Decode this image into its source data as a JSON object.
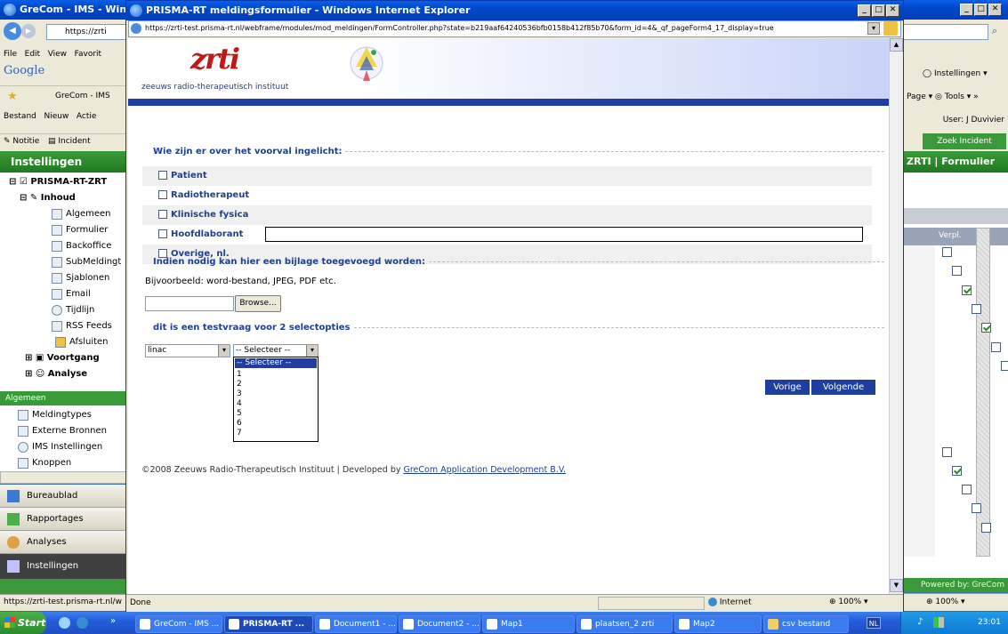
{
  "bg_window": {
    "title": "GreCom - IMS - Windo",
    "url": "https://zrti",
    "menu": [
      "File",
      "Edit",
      "View",
      "Favorit"
    ],
    "tab": "GreCom - IMS",
    "app_menu": [
      "Bestand",
      "Nieuw",
      "Actie"
    ],
    "toolbar": [
      "Notitie",
      "Incident"
    ],
    "sidebar_header": "Instellingen",
    "tree_root": "PRISMA-RT-ZRT",
    "tree_inhoud": "Inhoud",
    "tree_items": [
      "Algemeen",
      "Formulier",
      "Backoffice",
      "SubMeldingt",
      "Sjablonen",
      "Email",
      "Tijdlijn",
      "RSS Feeds",
      "Afsluiten"
    ],
    "tree_voortgang": "Voortgang",
    "tree_analyse": "Analyse",
    "algemeen_header": "Algemeen",
    "algemeen_items": [
      "Meldingtypes",
      "Externe Bronnen",
      "IMS Instellingen",
      "Knoppen"
    ],
    "nav_buttons": [
      "Bureaublad",
      "Rapportages",
      "Analyses",
      "Instellingen"
    ],
    "status_url": "https://zrti-test.prisma-rt.nl/w"
  },
  "right_window": {
    "instellingen": "Instellingen",
    "page": "Page",
    "tools": "Tools",
    "user": "User: J Duvivier",
    "zoek": "Zoek Incident",
    "title": "ZRTI | Formulier",
    "col": "Verpl.",
    "checks": [
      false,
      false,
      true,
      false,
      true,
      false,
      false,
      false,
      false,
      false,
      false,
      true,
      false,
      false,
      false
    ],
    "powered": "Powered by: GreCom",
    "zoom": "100%"
  },
  "popup": {
    "title": "PRISMA-RT meldingsformulier - Windows Internet Explorer",
    "url": "https://zrti-test.prisma-rt.nl/webframe/modules/mod_meldingen/FormController.php?state=b219aaf64240536bfb0158b412f85b70&form_id=4&_qf_pageForm4_17_display=true",
    "logo": "zrti",
    "logo_sub": "zeeuws radio-therapeutisch instituut",
    "q1": "Wie zijn er over het voorval ingelicht:",
    "options": [
      "Patient",
      "Radiotherapeut",
      "Klinische fysica",
      "Hoofdlaborant",
      "Overige, nl."
    ],
    "q2": "Indien nodig kan hier een bijlage toegevoegd worden:",
    "q2_hint": "Bijvoorbeeld: word-bestand, JPEG, PDF etc.",
    "browse": "Browse...",
    "q3": "dit is een testvraag voor 2 selectopties",
    "select1": "linac",
    "select2": "-- Selecteer --",
    "dropdown": [
      "-- Selecteer --",
      "1",
      "2",
      "3",
      "4",
      "5",
      "6",
      "7"
    ],
    "prev": "Vorige",
    "next": "Volgende",
    "footer": "©2008 Zeeuws Radio-Therapeutisch Instituut | Developed by ",
    "footer_link": "GreCom Application Development B.V.",
    "status": "Done",
    "zone": "Internet",
    "zoom": "100%"
  },
  "taskbar": {
    "start": "Start",
    "items": [
      "GreCom - IMS ...",
      "PRISMA-RT ...",
      "Document1 - ...",
      "Document2 - ...",
      "Map1",
      "plaatsen_2 zrti",
      "Map2",
      "csv bestand"
    ],
    "lang": "NL",
    "clock": "23:01"
  }
}
